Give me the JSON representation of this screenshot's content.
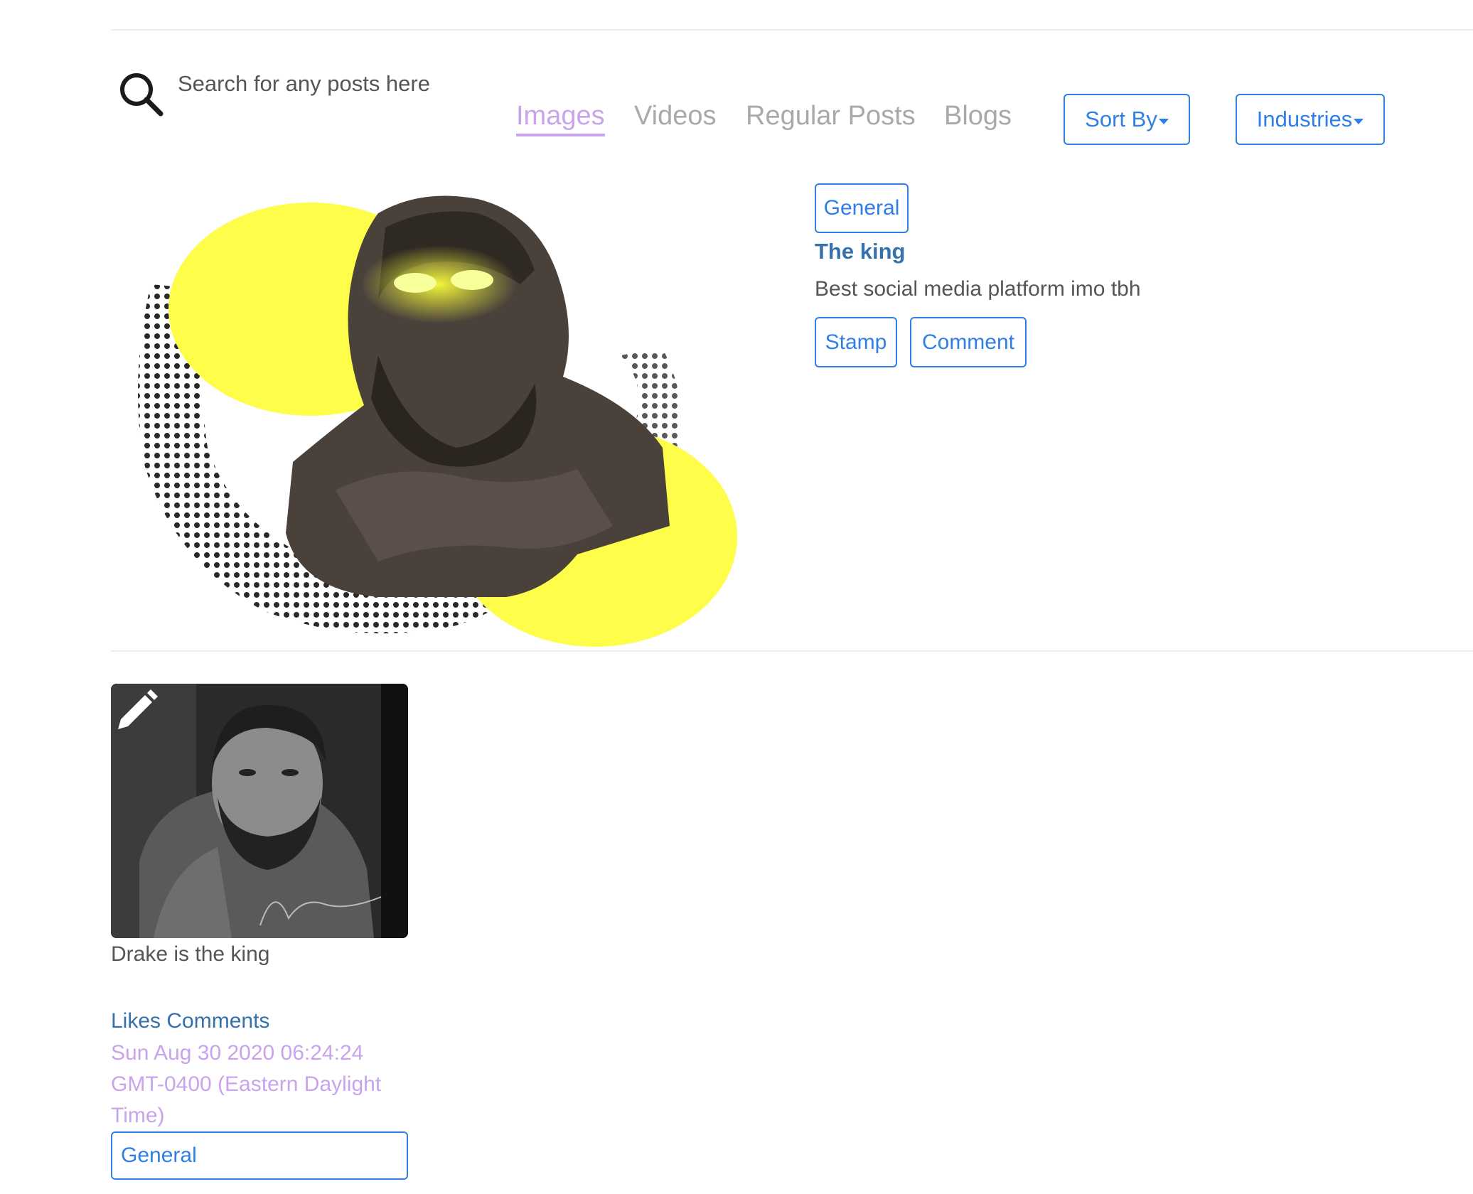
{
  "search": {
    "placeholder": "Search for any posts here"
  },
  "tabs": [
    {
      "label": "Images",
      "active": true
    },
    {
      "label": "Videos",
      "active": false
    },
    {
      "label": "Regular Posts",
      "active": false
    },
    {
      "label": "Blogs",
      "active": false
    }
  ],
  "filters": {
    "sort_label": "Sort By",
    "industries_label": "Industries"
  },
  "featured": {
    "image_icon": "statue-collage-image",
    "category": "General",
    "title": "The king",
    "description": "Best social media platform imo tbh",
    "stamp_label": "Stamp",
    "comment_label": "Comment"
  },
  "post": {
    "image_icon": "portrait-photo",
    "caption": "Drake is the king",
    "likes_label": "Likes",
    "comments_label": "Comments",
    "date": "Sun Aug 30 2020 06:24:24 GMT-0400 (Eastern Daylight Time)",
    "category": "General"
  },
  "colors": {
    "accent": "#2f7fe6",
    "active_tab": "#c9a4ec",
    "title_blue": "#3771ab",
    "yellow": "#fdfd4a"
  }
}
